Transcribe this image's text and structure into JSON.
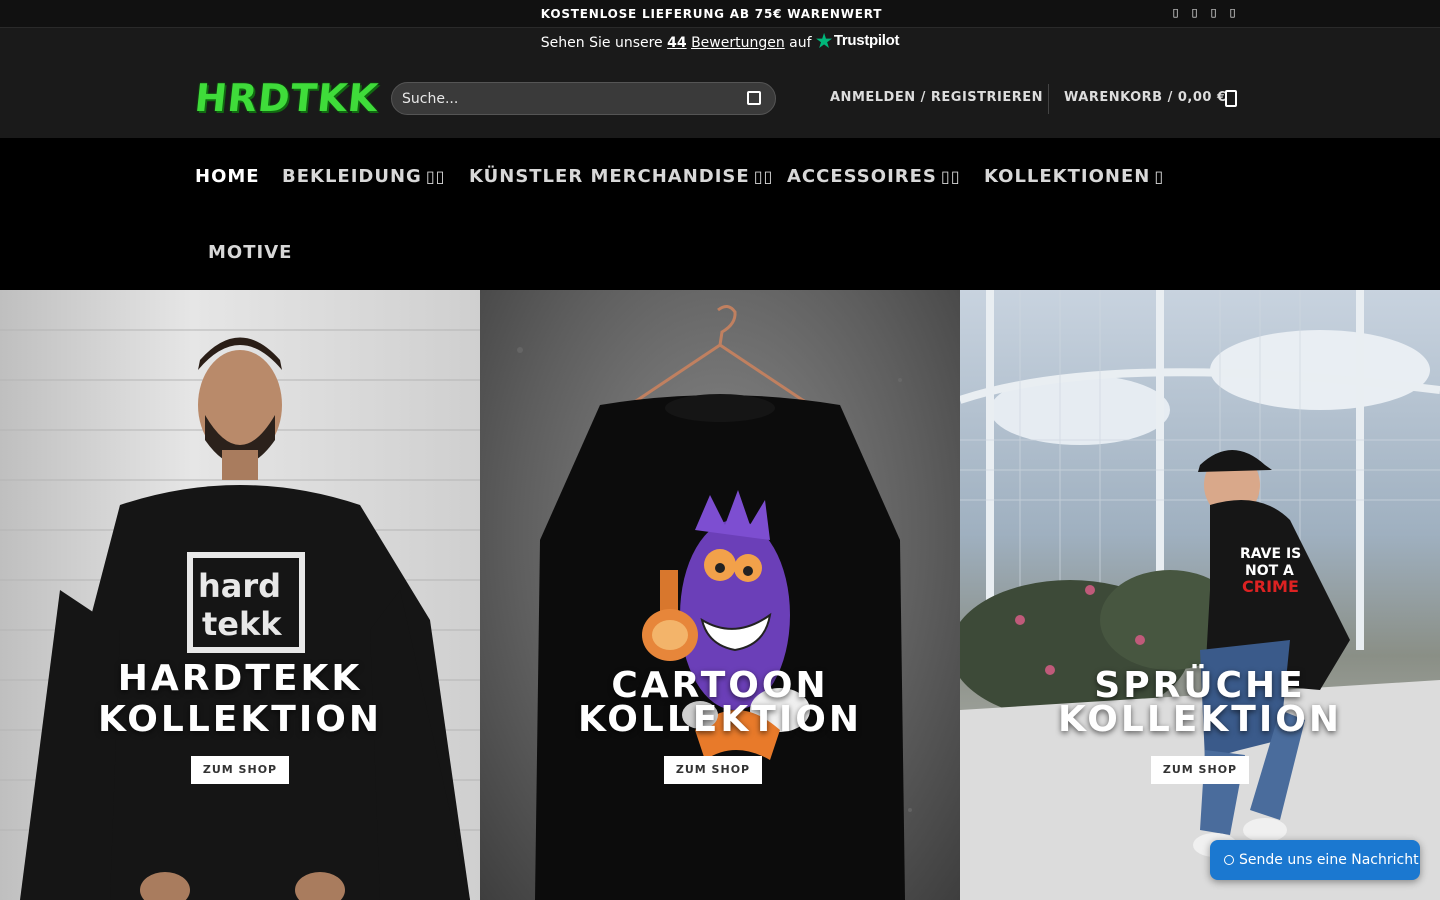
{
  "topbar": {
    "shipping_text": "KOSTENLOSE LIEFERUNG AB 75€ WARENWERT",
    "social_icons": [
      "facebook-icon",
      "instagram-icon",
      "youtube-icon",
      "tiktok-icon"
    ]
  },
  "trust": {
    "prefix": "Sehen Sie unsere",
    "count": "44",
    "reviews_label": "Bewertungen",
    "suffix": "auf",
    "brand": "Trustpilot",
    "brand_color": "#00b67a"
  },
  "header": {
    "logo_text": "HRDTKK",
    "logo_color": "#3fdc3a",
    "search_placeholder": "Suche...",
    "login_label": "ANMELDEN / REGISTRIEREN",
    "cart_label": "WARENKORB / 0,00 €"
  },
  "nav": {
    "items": [
      {
        "label": "HOME",
        "active": true
      },
      {
        "label": "BEKLEIDUNG",
        "dropdown": true
      },
      {
        "label": "KÜNSTLER MERCHANDISE",
        "dropdown": true
      },
      {
        "label": "ACCESSOIRES",
        "dropdown": true
      },
      {
        "label": "KOLLEKTIONEN",
        "dropdown": true
      },
      {
        "label": "MOTIVE"
      }
    ]
  },
  "hero": {
    "panels": [
      {
        "title_line1": "HARDTEKK",
        "title_line2": "KOLLEKTION",
        "button": "ZUM SHOP",
        "print_line1": "hard",
        "print_line2": "tekk"
      },
      {
        "title_line1": "CARTOON",
        "title_line2": "KOLLEKTION",
        "button": "ZUM SHOP"
      },
      {
        "title_line1": "SPRÜCHE",
        "title_line2": "KOLLEKTION",
        "button": "ZUM SHOP",
        "print_line1": "RAVE IS",
        "print_line2": "NOT A",
        "print_line3": "CRIME"
      }
    ]
  },
  "chat": {
    "label": "Sende uns eine Nachricht",
    "color": "#1b78d0"
  }
}
